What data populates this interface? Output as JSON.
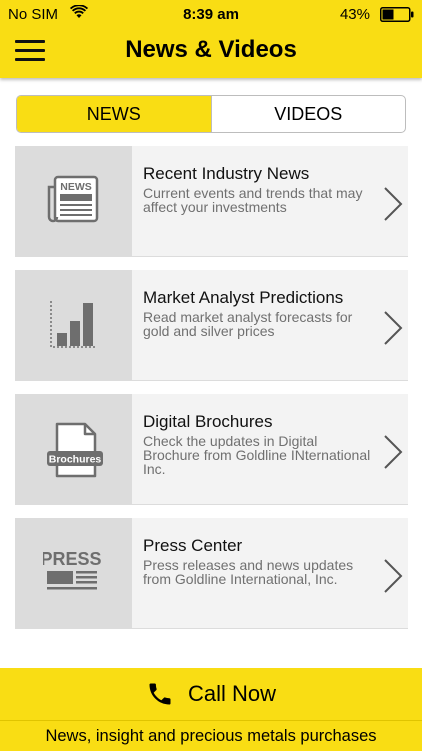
{
  "status_bar": {
    "carrier": "No SIM",
    "time": "8:39 am",
    "battery": "43%",
    "battery_level": 0.43
  },
  "header": {
    "title": "News & Videos",
    "menu_icon": "hamburger-menu-icon"
  },
  "tabs": [
    {
      "label": "NEWS",
      "active": true
    },
    {
      "label": "VIDEOS",
      "active": false
    }
  ],
  "items": [
    {
      "title": "Recent Industry News",
      "description": "Current events and trends that may affect your investments",
      "icon": "newspaper-icon",
      "icon_text": "NEWS"
    },
    {
      "title": "Market Analyst Predictions",
      "description": "Read market analyst forecasts for gold and silver prices",
      "icon": "bar-chart-icon"
    },
    {
      "title": "Digital Brochures",
      "description": "Check the updates in Digital Brochure from Goldline INternational Inc.",
      "icon": "brochure-icon",
      "icon_text": "Brochures"
    },
    {
      "title": "Press Center",
      "description": "Press releases and news updates from Goldline International, Inc.",
      "icon": "press-icon",
      "icon_text": "PRESS"
    }
  ],
  "call_bar": {
    "label": "Call Now",
    "icon": "phone-icon"
  },
  "tagline": "News, insight and precious metals purchases",
  "colors": {
    "accent": "#f9dd14",
    "card_bg": "#f3f3f3",
    "thumb_bg": "#dcdcdc",
    "icon": "#6e6e6e"
  }
}
